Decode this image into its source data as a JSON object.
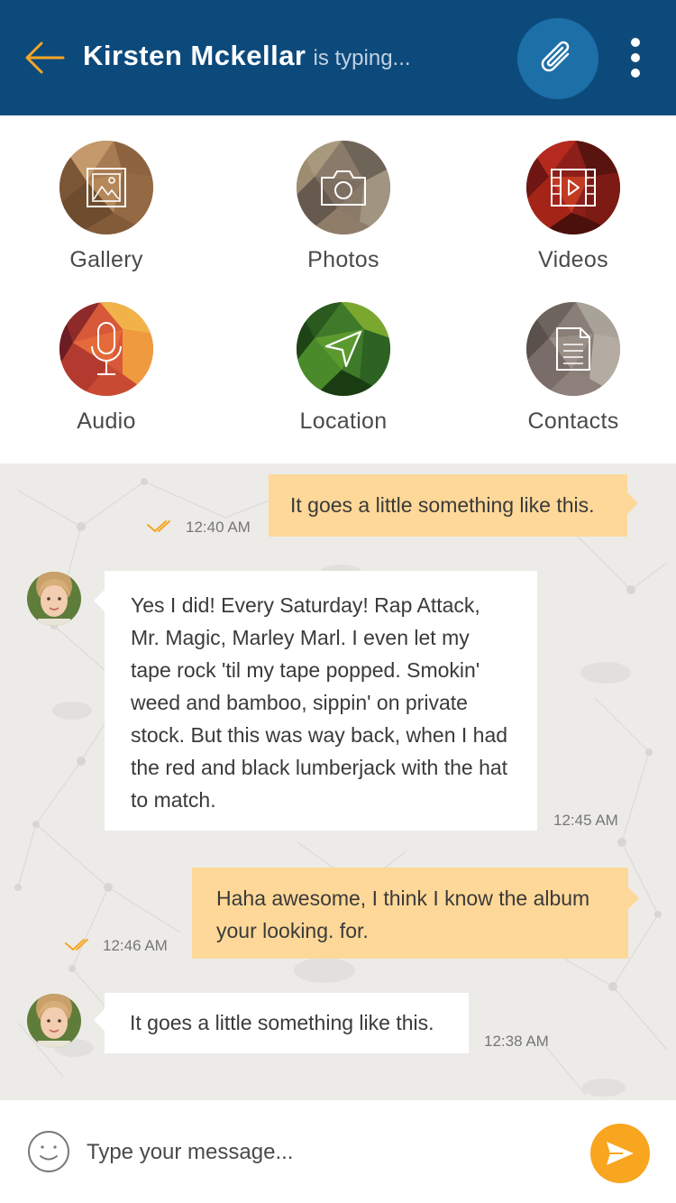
{
  "header": {
    "contact_name": "Kirsten Mckellar",
    "status": "is typing...",
    "back_icon": "arrow-left-icon",
    "attach_icon": "paperclip-icon",
    "more_icon": "more-vertical-icon",
    "bg_color": "#0d4a7c",
    "accent_color": "#f5a623"
  },
  "attachments": [
    {
      "label": "Gallery",
      "icon": "gallery-icon"
    },
    {
      "label": "Photos",
      "icon": "camera-icon"
    },
    {
      "label": "Videos",
      "icon": "film-icon"
    },
    {
      "label": "Audio",
      "icon": "microphone-icon"
    },
    {
      "label": "Location",
      "icon": "navigation-icon"
    },
    {
      "label": "Contacts",
      "icon": "document-icon"
    }
  ],
  "messages": [
    {
      "direction": "out",
      "text": "It goes a little something like this.",
      "time": "12:40 AM",
      "read": true
    },
    {
      "direction": "in",
      "text": "Yes I did! Every Saturday! Rap Attack, Mr. Magic, Marley Marl. I even let my tape rock 'til my tape popped. Smokin' weed and bamboo, sippin' on private stock. But this was way back, when I had the red and black lumberjack with the hat to match.",
      "time": "12:45 AM"
    },
    {
      "direction": "out",
      "text": "Haha awesome,  I think I know the album your looking. for.",
      "time": "12:46 AM",
      "read": true
    },
    {
      "direction": "in",
      "text": "It goes a little something like this.",
      "time": "12:38 AM"
    }
  ],
  "composer": {
    "placeholder": "Type your message...",
    "emoji_icon": "smiley-icon",
    "send_icon": "send-icon",
    "send_color": "#f8a51f"
  },
  "colors": {
    "outgoing_bubble": "#fed898",
    "incoming_bubble": "#ffffff",
    "chat_background": "#ecebe8"
  }
}
